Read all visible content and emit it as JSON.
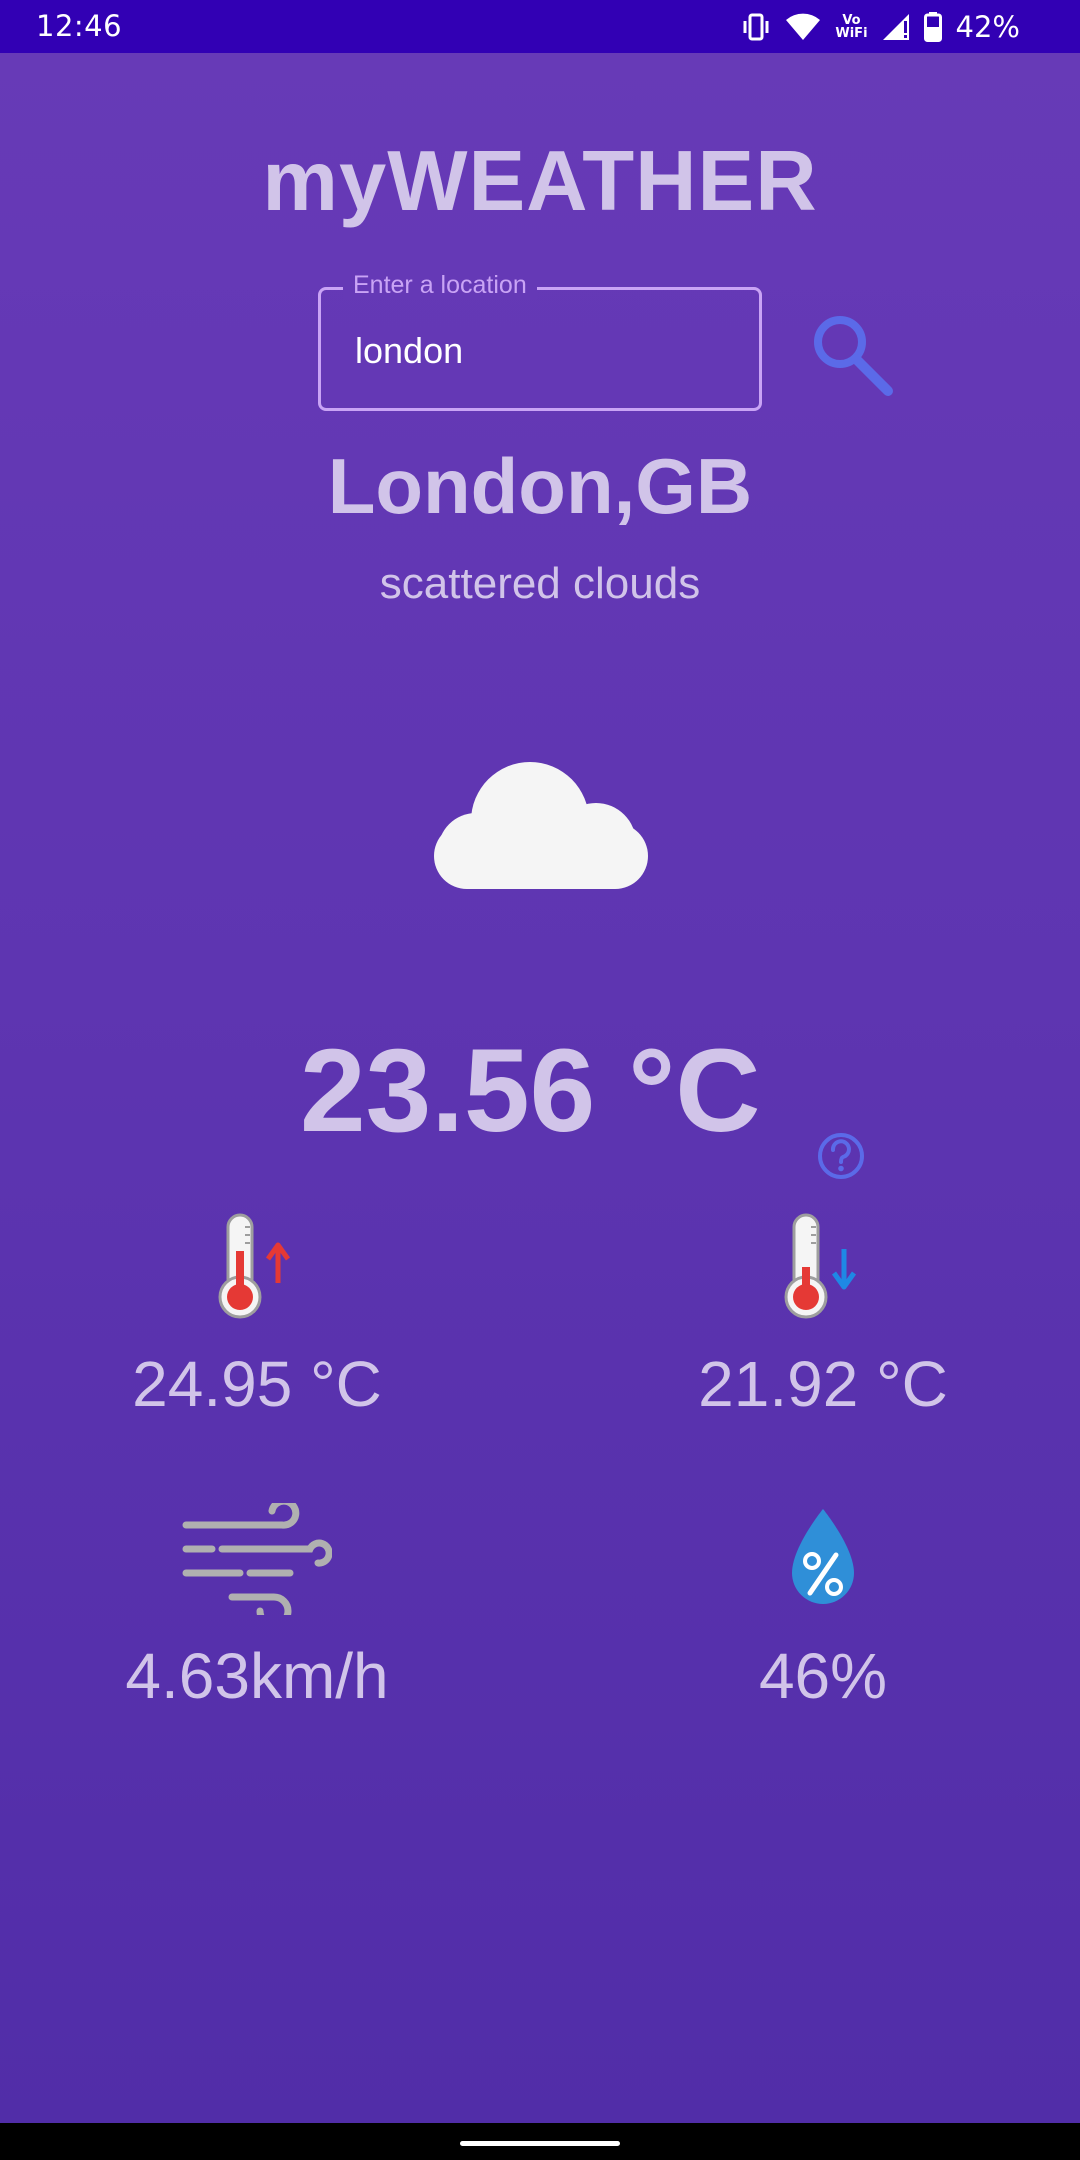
{
  "status_bar": {
    "time": "12:46",
    "volte_top": "Vo",
    "volte_bottom": "WiFi",
    "battery_percent": "42%"
  },
  "app": {
    "title": "myWEATHER"
  },
  "search": {
    "label": "Enter a location",
    "value": "london"
  },
  "weather": {
    "location": "London,GB",
    "description": "scattered clouds",
    "condition_icon": "cloud-icon",
    "temperature": "23.56 °C",
    "max_temperature": "24.95 °C",
    "min_temperature": "21.92 °C",
    "wind_speed": "4.63km/h",
    "humidity": "46%"
  },
  "colors": {
    "status_bar": "#3200b4",
    "background_top": "#673ab7",
    "background_bottom": "#512da8",
    "text": "#d1c4e9",
    "accent": "#5b6ae8",
    "field_border": "#c9a4f5"
  }
}
